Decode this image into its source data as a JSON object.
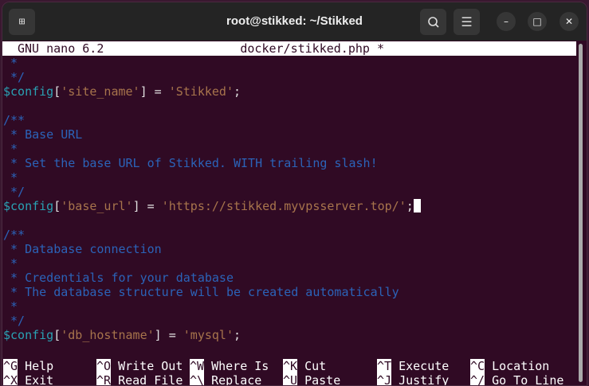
{
  "window": {
    "title": "root@stikked: ~/Stikked"
  },
  "header": {
    "app": "GNU nano 6.2",
    "file": "docker/stikked.php *"
  },
  "lines": [
    [
      {
        "t": " *",
        "c": "c"
      }
    ],
    [
      {
        "t": " */",
        "c": "c"
      }
    ],
    [
      {
        "t": "$config",
        "c": "v"
      },
      {
        "t": "[",
        "c": "p"
      },
      {
        "t": "'site_name'",
        "c": "s"
      },
      {
        "t": "] = ",
        "c": "p"
      },
      {
        "t": "'Stikked'",
        "c": "s"
      },
      {
        "t": ";",
        "c": "p"
      }
    ],
    [],
    [
      {
        "t": "/**",
        "c": "c"
      }
    ],
    [
      {
        "t": " * Base URL",
        "c": "c"
      }
    ],
    [
      {
        "t": " *",
        "c": "c"
      }
    ],
    [
      {
        "t": " * Set the base URL of Stikked. WITH trailing slash!",
        "c": "c"
      }
    ],
    [
      {
        "t": " *",
        "c": "c"
      }
    ],
    [
      {
        "t": " */",
        "c": "c"
      }
    ],
    [
      {
        "t": "$config",
        "c": "v"
      },
      {
        "t": "[",
        "c": "p"
      },
      {
        "t": "'base_url'",
        "c": "s"
      },
      {
        "t": "] = ",
        "c": "p"
      },
      {
        "t": "'https://stikked.myvpsserver.top/'",
        "c": "s"
      },
      {
        "t": ";",
        "c": "p"
      },
      {
        "cursor": true
      }
    ],
    [],
    [
      {
        "t": "/**",
        "c": "c"
      }
    ],
    [
      {
        "t": " * Database connection",
        "c": "c"
      }
    ],
    [
      {
        "t": " *",
        "c": "c"
      }
    ],
    [
      {
        "t": " * Credentials for your database",
        "c": "c"
      }
    ],
    [
      {
        "t": " * The database structure will be created automatically",
        "c": "c"
      }
    ],
    [
      {
        "t": " *",
        "c": "c"
      }
    ],
    [
      {
        "t": " */",
        "c": "c"
      }
    ],
    [
      {
        "t": "$config",
        "c": "v"
      },
      {
        "t": "[",
        "c": "p"
      },
      {
        "t": "'db_hostname'",
        "c": "s"
      },
      {
        "t": "] = ",
        "c": "p"
      },
      {
        "t": "'mysql'",
        "c": "s"
      },
      {
        "t": ";",
        "c": "p"
      }
    ]
  ],
  "shortcuts": [
    [
      {
        "key": "^G",
        "label": "Help"
      },
      {
        "key": "^O",
        "label": "Write Out"
      },
      {
        "key": "^W",
        "label": "Where Is"
      },
      {
        "key": "^K",
        "label": "Cut"
      },
      {
        "key": "^T",
        "label": "Execute"
      },
      {
        "key": "^C",
        "label": "Location"
      }
    ],
    [
      {
        "key": "^X",
        "label": "Exit"
      },
      {
        "key": "^R",
        "label": "Read File"
      },
      {
        "key": "^\\",
        "label": "Replace"
      },
      {
        "key": "^U",
        "label": "Paste"
      },
      {
        "key": "^J",
        "label": "Justify"
      },
      {
        "key": "^/",
        "label": "Go To Line"
      }
    ]
  ]
}
